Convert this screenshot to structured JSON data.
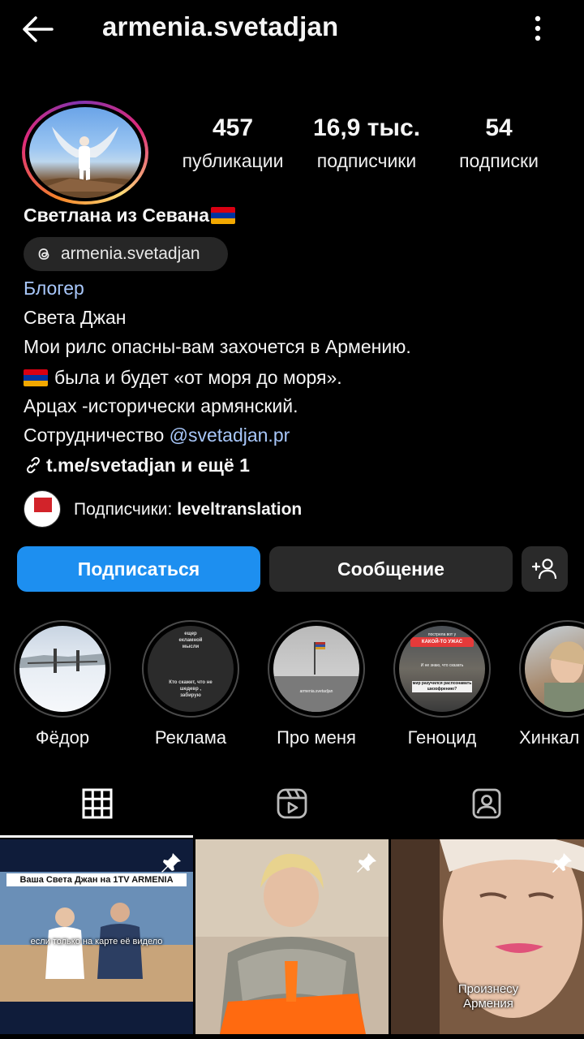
{
  "header": {
    "username": "armenia.svetadjan"
  },
  "profile": {
    "stats": [
      {
        "value": "457",
        "label": "публикации"
      },
      {
        "value": "16,9 тыс.",
        "label": "подписчики"
      },
      {
        "value": "54",
        "label": "подписки"
      }
    ],
    "display_name": "Светлана из Севана",
    "threads_handle": "armenia.svetadjan",
    "category": "Блогер",
    "bio_lines": [
      "Света Джан",
      "Мои рилс опасны-вам захочется в Армению.",
      "была и будет «от моря до моря».",
      "Арцах -исторически армянский.",
      "Сотрудничество "
    ],
    "bio_mention": "@svetadjan.pr",
    "link_text": "t.me/svetadjan и ещё 1",
    "followers_prefix": "Подписчики: ",
    "followers_name": "leveltranslation"
  },
  "buttons": {
    "follow": "Подписаться",
    "message": "Сообщение"
  },
  "highlights": [
    {
      "label": "Фёдор"
    },
    {
      "label": "Реклама"
    },
    {
      "label": "Про меня"
    },
    {
      "label": "Геноцид"
    },
    {
      "label": "Хинкал"
    }
  ],
  "highlight_texts": {
    "reklama_top": "ещер\nекламной\nмысли",
    "reklama_bottom": "Кто скажет, что не\nшедевр ,\nзабирую",
    "pro_menya_caption": "armenia.svetadjan",
    "genocid_banner": "КАКОЙ-ТО УЖАС",
    "genocid_top": "пострела вот у",
    "genocid_mid": "И не знаю, что сказать",
    "genocid_low": "мир разучился распознавать шизофрению?"
  },
  "posts": [
    {
      "title": "Ваша Света Джан на 1TV ARMENIA",
      "caption": "если только на карте её видело"
    },
    {
      "caption": ""
    },
    {
      "caption": "Произнесу\nАрмения"
    }
  ],
  "colors": {
    "accent": "#1d8ff0",
    "link": "#a8c7fa",
    "background": "#000000",
    "secondary_button": "#2a2a2a"
  }
}
